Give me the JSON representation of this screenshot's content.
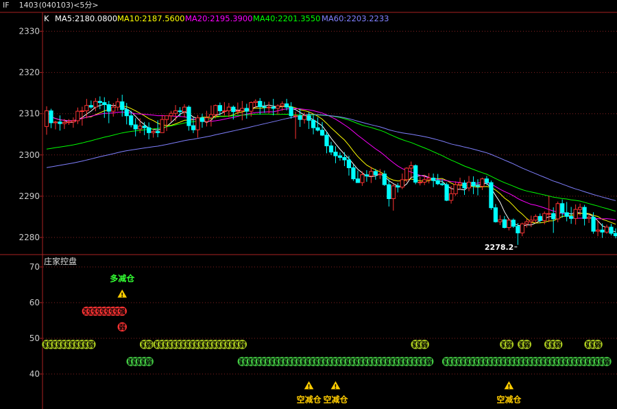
{
  "header": {
    "symbol": "IF",
    "contract": "1403",
    "code": "(040103)",
    "period": "<5分>"
  },
  "price_panel": {
    "indicator_label": "K",
    "ma_legend": [
      {
        "label": "MA5:2180.0800",
        "color": "#ffffff"
      },
      {
        "label": "MA10:2187.5600",
        "color": "#ffff00"
      },
      {
        "label": "MA20:2195.3900",
        "color": "#ff00ff"
      },
      {
        "label": "MA40:2201.3550",
        "color": "#00ff00"
      },
      {
        "label": "MA60:2203.2233",
        "color": "#8080ff"
      }
    ],
    "y_ticks": [
      "2330",
      "2320",
      "2310",
      "2300",
      "2290",
      "2280"
    ],
    "low_marker": "2278.2",
    "up_color": "#ff3333",
    "down_color": "#00ffff"
  },
  "indicator_panel": {
    "title": "庄家控盘",
    "y_ticks": [
      "70",
      "60",
      "50",
      "40"
    ],
    "signals": [
      {
        "text": "多减仓",
        "color": "#33ff33",
        "col": 17,
        "pos": "top"
      },
      {
        "text": "空减仓",
        "color": "#ffcc00",
        "col": 59,
        "pos": "bottom"
      },
      {
        "text": "空减仓",
        "color": "#ffcc00",
        "col": 65,
        "pos": "bottom"
      },
      {
        "text": "空减仓",
        "color": "#ffcc00",
        "col": 104,
        "pos": "bottom"
      }
    ],
    "badges": {
      "strong": "强",
      "weak": "弱",
      "strong_color": "#ff3333",
      "weak_color": "#b0d020",
      "weak_low_color": "#44cc44"
    }
  },
  "chart_data": {
    "type": "candlestick",
    "title": "",
    "ylim_price": [
      2275,
      2335
    ],
    "ylim_indicator": [
      35,
      72
    ],
    "candles_ohlc": [
      [
        2306.9,
        2311.8,
        2304.9,
        2310.7
      ],
      [
        2310.7,
        2311.2,
        2306.5,
        2307.8
      ],
      [
        2307.8,
        2308.3,
        2306.2,
        2308.0
      ],
      [
        2308.0,
        2309.6,
        2305.9,
        2307.6
      ],
      [
        2307.6,
        2308.7,
        2306.3,
        2307.9
      ],
      [
        2307.9,
        2308.7,
        2307.3,
        2308.0
      ],
      [
        2308.0,
        2309.1,
        2306.6,
        2308.3
      ],
      [
        2308.3,
        2311.5,
        2307.5,
        2310.6
      ],
      [
        2310.6,
        2311.7,
        2307.1,
        2310.7
      ],
      [
        2310.7,
        2313.6,
        2308.9,
        2312.0
      ],
      [
        2312.0,
        2313.2,
        2311.2,
        2311.6
      ],
      [
        2311.6,
        2313.8,
        2310.6,
        2313.0
      ],
      [
        2313.0,
        2314.2,
        2311.1,
        2312.7
      ],
      [
        2312.7,
        2314.0,
        2309.0,
        2312.2
      ],
      [
        2312.2,
        2313.1,
        2307.7,
        2310.6
      ],
      [
        2310.6,
        2312.6,
        2309.3,
        2311.6
      ],
      [
        2311.6,
        2313.8,
        2310.7,
        2312.9
      ],
      [
        2312.9,
        2314.6,
        2309.3,
        2311.0
      ],
      [
        2311.0,
        2312.6,
        2307.4,
        2309.5
      ],
      [
        2309.5,
        2310.7,
        2306.7,
        2307.3
      ],
      [
        2307.3,
        2308.9,
        2304.5,
        2306.3
      ],
      [
        2306.3,
        2308.9,
        2305.3,
        2307.0
      ],
      [
        2307.0,
        2308.0,
        2304.8,
        2306.6
      ],
      [
        2306.6,
        2307.9,
        2303.8,
        2305.4
      ],
      [
        2305.4,
        2306.3,
        2304.2,
        2305.7
      ],
      [
        2305.7,
        2308.4,
        2304.3,
        2305.4
      ],
      [
        2305.4,
        2309.7,
        2305.4,
        2308.6
      ],
      [
        2308.6,
        2309.5,
        2305.8,
        2309.5
      ],
      [
        2309.5,
        2310.7,
        2308.0,
        2310.1
      ],
      [
        2310.1,
        2312.1,
        2308.2,
        2310.7
      ],
      [
        2310.7,
        2311.6,
        2309.4,
        2310.5
      ],
      [
        2310.5,
        2312.3,
        2309.1,
        2311.6
      ],
      [
        2311.6,
        2312.0,
        2305.9,
        2307.1
      ],
      [
        2307.1,
        2309.1,
        2305.3,
        2306.1
      ],
      [
        2306.1,
        2309.7,
        2304.2,
        2309.0
      ],
      [
        2309.0,
        2310.0,
        2306.6,
        2308.1
      ],
      [
        2308.1,
        2310.7,
        2306.9,
        2309.0
      ],
      [
        2309.0,
        2312.0,
        2306.9,
        2309.8
      ],
      [
        2309.8,
        2312.2,
        2308.9,
        2312.0
      ],
      [
        2312.0,
        2312.7,
        2309.6,
        2310.7
      ],
      [
        2310.7,
        2312.8,
        2309.6,
        2310.7
      ],
      [
        2310.7,
        2312.6,
        2309.2,
        2311.6
      ],
      [
        2311.6,
        2312.0,
        2308.6,
        2310.5
      ],
      [
        2310.5,
        2312.7,
        2309.8,
        2310.7
      ],
      [
        2310.7,
        2313.1,
        2308.4,
        2311.3
      ],
      [
        2311.3,
        2312.4,
        2308.8,
        2310.6
      ],
      [
        2310.6,
        2313.0,
        2309.3,
        2312.7
      ],
      [
        2312.7,
        2313.5,
        2311.5,
        2313.0
      ],
      [
        2313.0,
        2313.8,
        2309.8,
        2311.7
      ],
      [
        2311.7,
        2312.9,
        2310.2,
        2311.6
      ],
      [
        2311.6,
        2312.9,
        2310.1,
        2311.6
      ],
      [
        2311.6,
        2313.6,
        2309.6,
        2311.3
      ],
      [
        2311.3,
        2312.3,
        2309.8,
        2311.9
      ],
      [
        2311.9,
        2313.0,
        2310.7,
        2312.4
      ],
      [
        2312.4,
        2313.6,
        2310.8,
        2311.6
      ],
      [
        2311.6,
        2312.8,
        2308.8,
        2309.5
      ],
      [
        2309.5,
        2310.5,
        2303.9,
        2309.5
      ],
      [
        2309.5,
        2311.2,
        2306.8,
        2308.6
      ],
      [
        2308.6,
        2310.3,
        2307.6,
        2309.5
      ],
      [
        2309.5,
        2310.4,
        2306.3,
        2308.4
      ],
      [
        2308.4,
        2309.6,
        2305.0,
        2306.6
      ],
      [
        2306.6,
        2309.1,
        2305.7,
        2306.0
      ],
      [
        2306.0,
        2308.0,
        2304.6,
        2304.8
      ],
      [
        2304.8,
        2305.6,
        2300.4,
        2302.2
      ],
      [
        2302.2,
        2303.2,
        2300.0,
        2300.7
      ],
      [
        2300.7,
        2302.1,
        2298.0,
        2299.8
      ],
      [
        2299.8,
        2300.6,
        2298.6,
        2299.4
      ],
      [
        2299.4,
        2300.7,
        2297.3,
        2298.8
      ],
      [
        2298.8,
        2299.8,
        2295.0,
        2296.9
      ],
      [
        2296.9,
        2297.7,
        2293.7,
        2294.2
      ],
      [
        2294.2,
        2296.2,
        2293.3,
        2293.3
      ],
      [
        2293.3,
        2296.0,
        2292.5,
        2295.2
      ],
      [
        2295.2,
        2296.3,
        2293.5,
        2294.9
      ],
      [
        2294.9,
        2297.1,
        2293.2,
        2296.0
      ],
      [
        2296.0,
        2296.6,
        2294.0,
        2295.2
      ],
      [
        2295.2,
        2296.6,
        2294.2,
        2295.4
      ],
      [
        2295.4,
        2296.2,
        2292.5,
        2292.8
      ],
      [
        2292.8,
        2294.1,
        2287.5,
        2289.4
      ],
      [
        2289.4,
        2293.0,
        2286.5,
        2292.5
      ],
      [
        2292.5,
        2293.2,
        2290.9,
        2292.2
      ],
      [
        2292.2,
        2295.5,
        2291.7,
        2294.0
      ],
      [
        2294.0,
        2297.0,
        2293.4,
        2296.8
      ],
      [
        2296.8,
        2298.4,
        2294.6,
        2297.4
      ],
      [
        2297.4,
        2297.7,
        2292.9,
        2293.4
      ],
      [
        2293.4,
        2294.7,
        2292.6,
        2293.4
      ],
      [
        2293.4,
        2295.2,
        2292.7,
        2294.0
      ],
      [
        2294.0,
        2295.6,
        2293.1,
        2294.4
      ],
      [
        2294.4,
        2295.5,
        2292.2,
        2293.8
      ],
      [
        2293.8,
        2295.4,
        2292.7,
        2293.0
      ],
      [
        2293.0,
        2294.1,
        2292.5,
        2292.8
      ],
      [
        2292.8,
        2293.3,
        2288.8,
        2289.0
      ],
      [
        2289.0,
        2292.5,
        2288.2,
        2290.6
      ],
      [
        2290.6,
        2293.6,
        2290.1,
        2292.8
      ],
      [
        2292.8,
        2294.5,
        2291.6,
        2293.2
      ],
      [
        2293.2,
        2293.9,
        2290.3,
        2292.0
      ],
      [
        2292.0,
        2294.9,
        2291.2,
        2293.4
      ],
      [
        2293.4,
        2294.8,
        2290.5,
        2292.5
      ],
      [
        2292.5,
        2294.1,
        2290.2,
        2292.4
      ],
      [
        2292.4,
        2294.5,
        2291.5,
        2294.2
      ],
      [
        2294.2,
        2294.9,
        2292.7,
        2293.3
      ],
      [
        2293.3,
        2293.8,
        2286.7,
        2287.2
      ],
      [
        2287.2,
        2288.1,
        2283.6,
        2283.8
      ],
      [
        2283.8,
        2285.4,
        2283.0,
        2284.3
      ],
      [
        2284.3,
        2285.2,
        2282.2,
        2282.4
      ],
      [
        2282.4,
        2284.6,
        2281.7,
        2284.2
      ],
      [
        2284.2,
        2284.6,
        2282.3,
        2282.7
      ],
      [
        2282.7,
        2283.5,
        2278.2,
        2281.1
      ],
      [
        2281.1,
        2283.6,
        2280.3,
        2283.3
      ],
      [
        2283.3,
        2284.5,
        2282.4,
        2283.8
      ],
      [
        2283.8,
        2285.3,
        2282.5,
        2284.2
      ],
      [
        2284.2,
        2285.6,
        2283.5,
        2285.1
      ],
      [
        2285.1,
        2285.8,
        2283.5,
        2284.1
      ],
      [
        2284.1,
        2286.3,
        2283.2,
        2285.8
      ],
      [
        2285.8,
        2290.1,
        2283.7,
        2285.8
      ],
      [
        2285.8,
        2287.3,
        2281.1,
        2284.5
      ],
      [
        2284.5,
        2288.7,
        2283.7,
        2288.2
      ],
      [
        2288.2,
        2289.2,
        2284.8,
        2286.0
      ],
      [
        2286.0,
        2288.6,
        2283.9,
        2285.1
      ],
      [
        2285.1,
        2287.4,
        2283.3,
        2284.6
      ],
      [
        2284.6,
        2288.0,
        2283.1,
        2286.8
      ],
      [
        2286.8,
        2288.2,
        2285.3,
        2287.3
      ],
      [
        2287.3,
        2287.9,
        2282.9,
        2284.6
      ],
      [
        2284.6,
        2285.8,
        2283.5,
        2284.9
      ],
      [
        2284.9,
        2286.1,
        2280.9,
        2281.5
      ],
      [
        2281.5,
        2284.1,
        2280.3,
        2281.8
      ],
      [
        2281.8,
        2283.4,
        2279.9,
        2281.3
      ],
      [
        2281.3,
        2283.1,
        2280.9,
        2282.5
      ],
      [
        2282.5,
        2283.3,
        2280.5,
        2281.0
      ],
      [
        2281.0,
        2282.2,
        2279.8,
        2280.4
      ]
    ]
  }
}
